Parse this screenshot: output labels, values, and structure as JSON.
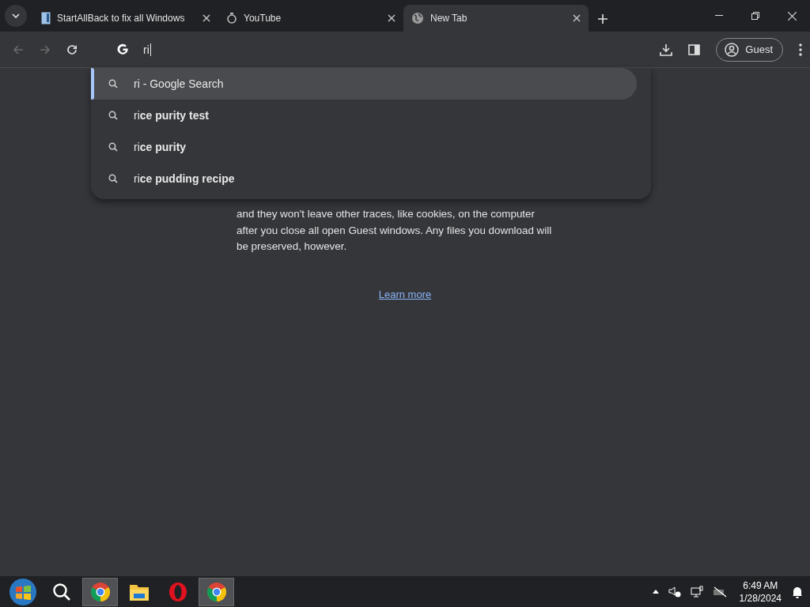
{
  "tabs": [
    {
      "title": "StartAllBack to fix all Windows",
      "selected": false
    },
    {
      "title": "YouTube",
      "selected": false
    },
    {
      "title": "New Tab",
      "selected": true
    }
  ],
  "toolbar": {
    "address_value": "ri",
    "profile": "Guest"
  },
  "suggestions": [
    {
      "text": "ri - Google Search",
      "selected": true
    },
    {
      "text": "ri**ce purity test**",
      "selected": false
    },
    {
      "text": "ri**ce purity**",
      "selected": false
    },
    {
      "text": "ri**ce pudding recipe**",
      "selected": false
    }
  ],
  "page": {
    "paragraph_lines": [
      "and they won't leave other traces, like cookies, on the computer",
      "after you close all open Guest windows. Any files you download will",
      "be preserved, however."
    ],
    "link": "Learn more"
  },
  "taskbar": {
    "items": [
      {
        "kind": "start",
        "active": false
      },
      {
        "kind": "search",
        "active": false
      },
      {
        "kind": "chrome",
        "active": true
      },
      {
        "kind": "folder",
        "active": false
      },
      {
        "kind": "opera",
        "active": false
      },
      {
        "kind": "chrome",
        "active": true
      }
    ],
    "time": "6:49 AM",
    "date": "1/28/2024"
  }
}
